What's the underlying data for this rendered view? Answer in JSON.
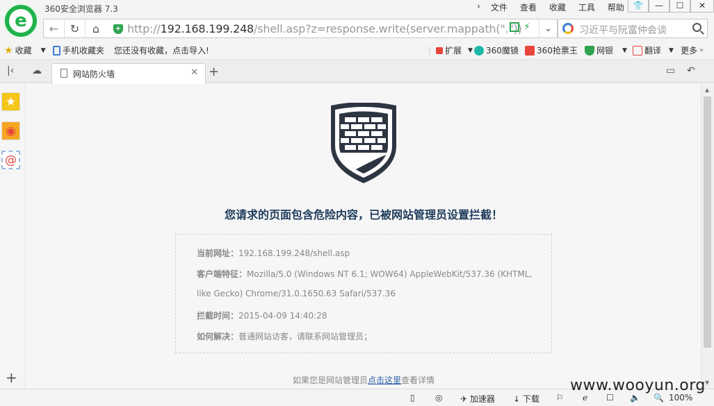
{
  "app": {
    "title": "360安全浏览器 7.3"
  },
  "menu": [
    "文件",
    "查看",
    "收藏",
    "工具",
    "帮助"
  ],
  "window_buttons": [
    "👕",
    "—",
    "☐",
    "✕"
  ],
  "address": {
    "prefix": "http://",
    "host": "192.168.199.248",
    "path": "/shell.asp?z=response.write(server.mappath(\".\"))"
  },
  "search": {
    "placeholder": "习近平与阮富仲会谈"
  },
  "bookmarks": {
    "favorites_label": "收藏",
    "mobile_label": "手机收藏夹",
    "import_hint": "您还没有收藏，点击导入!",
    "right": [
      "扩展",
      "360魔镜",
      "360抢票王",
      "网银",
      "翻译",
      "更多"
    ]
  },
  "tab": {
    "title": "网站防火墙"
  },
  "page": {
    "headline": "您请求的页面包含危险内容，已被网站管理员设置拦截！",
    "info": [
      {
        "label": "当前网址：",
        "value": "192.168.199.248/shell.asp"
      },
      {
        "label": "客户端特征：",
        "value": "Mozilla/5.0 (Windows NT 6.1; WOW64) AppleWebKit/537.36 (KHTML,"
      },
      {
        "label": "",
        "value": "like Gecko) Chrome/31.0.1650.63 Safari/537.36"
      },
      {
        "label": "拦截时间：",
        "value": "2015-04-09 14:40:28"
      },
      {
        "label": "如何解决：",
        "value": "普通网站访客，请联系网站管理员；"
      }
    ],
    "footer_prefix": "如果您是网站管理员",
    "footer_link": "点击这里",
    "footer_suffix": "查看详情"
  },
  "statusbar": {
    "accelerator": "加速器",
    "download": "下载",
    "zoom": "100%"
  },
  "watermark": "www.wooyun.org",
  "colors": {
    "brand_green": "#21b24b",
    "headline": "#1e3b5a",
    "wall": "#2e3542"
  }
}
